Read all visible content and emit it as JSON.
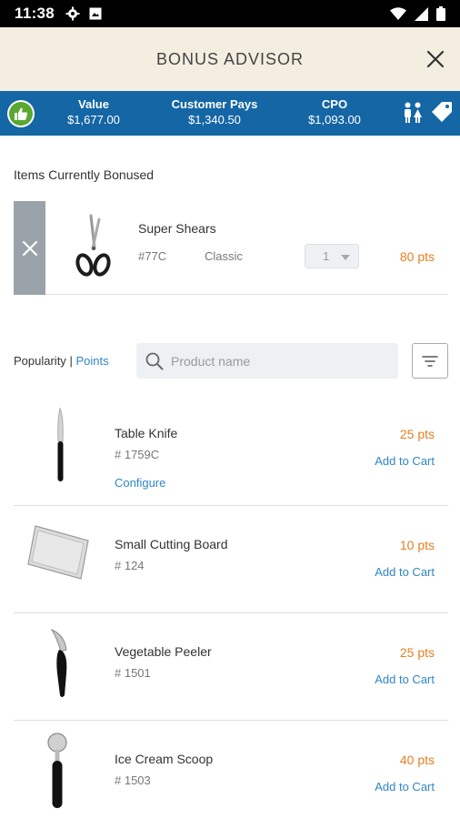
{
  "status_bar": {
    "time": "11:38",
    "icons": [
      "gear-icon",
      "image-icon",
      "wifi-icon",
      "signal-icon",
      "battery-icon"
    ]
  },
  "header": {
    "title": "BONUS ADVISOR",
    "close_icon": "close-icon"
  },
  "summary": {
    "value_label": "Value",
    "value_amount": "$1,677.00",
    "customer_pays_label": "Customer Pays",
    "customer_pays_amount": "$1,340.50",
    "cpo_label": "CPO",
    "cpo_amount": "$1,093.00",
    "icons": [
      "thumbs-up-icon",
      "people-icon",
      "tag-icon"
    ],
    "colors": {
      "bar": "#1566a5",
      "thumb": "#5aa832"
    }
  },
  "bonused": {
    "section_title": "Items Currently Bonused",
    "items": [
      {
        "name": "Super Shears",
        "sku": "#77C",
        "finish": "Classic",
        "quantity": "1",
        "points": "80 pts",
        "image_icon": "shears-icon"
      }
    ]
  },
  "sort": {
    "popularity_label": "Popularity",
    "separator": "|",
    "points_label": "Points"
  },
  "search": {
    "placeholder": "Product name",
    "value": ""
  },
  "products": [
    {
      "name": "Table Knife",
      "sku": "# 1759C",
      "points": "25 pts",
      "add_label": "Add to Cart",
      "configure_label": "Configure",
      "image_icon": "knife-icon"
    },
    {
      "name": "Small Cutting Board",
      "sku": "# 124",
      "points": "10 pts",
      "add_label": "Add to Cart",
      "image_icon": "cutting-board-icon"
    },
    {
      "name": "Vegetable Peeler",
      "sku": "# 1501",
      "points": "25 pts",
      "add_label": "Add to Cart",
      "image_icon": "peeler-icon"
    },
    {
      "name": "Ice Cream Scoop",
      "sku": "# 1503",
      "points": "40 pts",
      "add_label": "Add to Cart",
      "image_icon": "ice-cream-scoop-icon"
    }
  ],
  "colors": {
    "header_bg": "#f3eee0",
    "points": "#e67e22",
    "link": "#2f86c5"
  }
}
